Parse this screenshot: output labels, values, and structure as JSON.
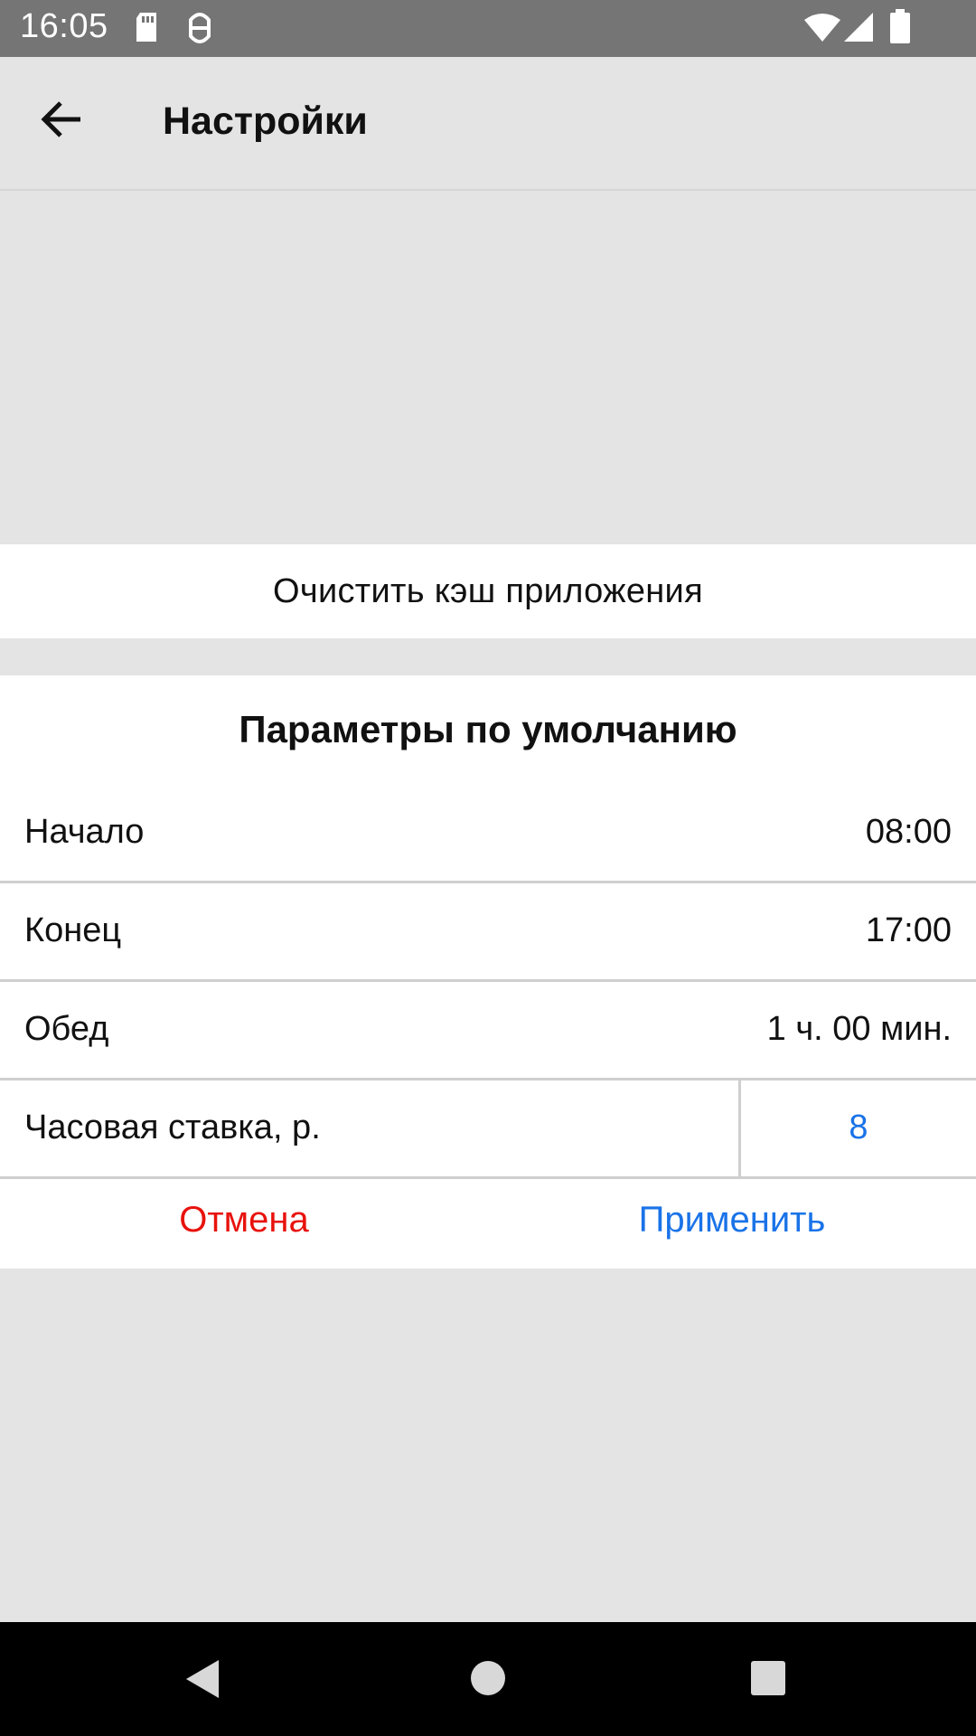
{
  "status_bar": {
    "time": "16:05",
    "icons": [
      "sd-card-icon",
      "android-debug-icon",
      "wifi-icon",
      "signal-icon",
      "battery-icon"
    ]
  },
  "app_bar": {
    "title": "Настройки",
    "back_icon": "arrow-back-icon"
  },
  "cache": {
    "label": "Очистить кэш приложения"
  },
  "defaults": {
    "title": "Параметры по умолчанию",
    "rows": [
      {
        "label": "Начало",
        "value": "08:00"
      },
      {
        "label": "Конец",
        "value": "17:00"
      },
      {
        "label": "Обед",
        "value": "1 ч. 00 мин."
      }
    ],
    "rate": {
      "label": "Часовая ставка, р.",
      "value": "8"
    },
    "cancel_label": "Отмена",
    "apply_label": "Применить"
  },
  "colors": {
    "status_bar": "#757575",
    "background": "#e4e4e4",
    "accent_blue": "#1a73e8",
    "cancel_red": "#e8120c"
  },
  "nav_bar": {
    "icons": [
      "back-triangle-icon",
      "home-circle-icon",
      "recents-square-icon"
    ]
  }
}
